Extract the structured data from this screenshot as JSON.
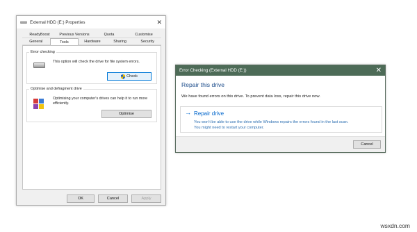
{
  "properties_window": {
    "title": "External HDD (E:) Properties",
    "tabs_row1": [
      "ReadyBoost",
      "Previous Versions",
      "Quota",
      "Customise"
    ],
    "tabs_row2": [
      "General",
      "Tools",
      "Hardware",
      "Sharing",
      "Security"
    ],
    "active_tab": "Tools",
    "error_checking": {
      "legend": "Error checking",
      "text": "This option will check the drive for file system errors.",
      "check_button": "Check"
    },
    "defrag": {
      "legend": "Optimise and defragment drive",
      "text": "Optimising your computer's drives can help it to run more efficiently.",
      "optimise_button": "Optimise"
    },
    "ok_button": "OK",
    "cancel_button": "Cancel",
    "apply_button": "Apply"
  },
  "error_dialog": {
    "title": "Error Checking (External HDD (E:))",
    "heading": "Repair this drive",
    "message": "We have found errors on this drive. To prevent data loss, repair this drive now.",
    "repair_title": "Repair drive",
    "repair_desc_line1": "You won't be able to use the drive while Windows repairs the errors found in the last scan.",
    "repair_desc_line2": "You might need to restart your computer.",
    "cancel_button": "Cancel"
  },
  "watermark": "wsxdn.com",
  "colors": {
    "dialog_title_bar": "#4d6b57",
    "link_blue": "#0066cc",
    "heading_blue": "#1e4e8c"
  }
}
